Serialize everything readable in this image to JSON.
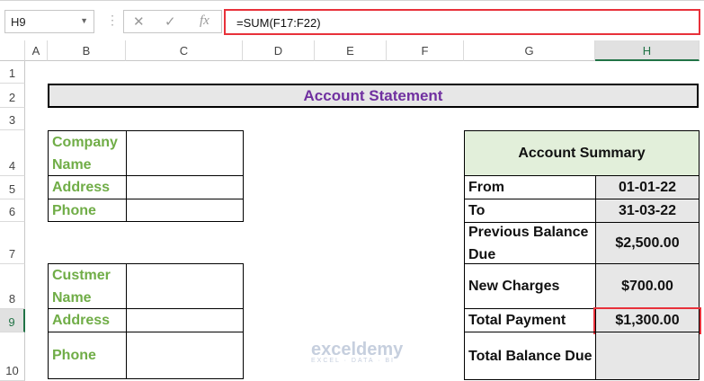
{
  "formula_bar": {
    "name_box": "H9",
    "formula": "=SUM(F17:F22)"
  },
  "columns": [
    "A",
    "B",
    "C",
    "D",
    "E",
    "F",
    "G",
    "H"
  ],
  "rows": [
    "1",
    "2",
    "3",
    "4",
    "5",
    "6",
    "7",
    "8",
    "9",
    "10"
  ],
  "sheet": {
    "title": "Account Statement",
    "company": {
      "name_label": "Company Name",
      "address_label": "Address",
      "phone_label": "Phone"
    },
    "customer": {
      "name_label": "Custmer Name",
      "address_label": "Address",
      "phone_label": "Phone"
    },
    "summary": {
      "header": "Account Summary",
      "items": [
        {
          "label": "From",
          "value": "01-01-22"
        },
        {
          "label": "To",
          "value": "31-03-22"
        },
        {
          "label": "Previous Balance Due",
          "value": "$2,500.00"
        },
        {
          "label": "New Charges",
          "value": "$700.00"
        },
        {
          "label": "Total Payment",
          "value": "$1,300.00"
        },
        {
          "label": "Total Balance Due",
          "value": ""
        }
      ]
    }
  },
  "watermark": {
    "brand": "exceldemy",
    "tagline": "EXCEL · DATA · BI"
  },
  "colors": {
    "label_green": "#70ad47",
    "title_purple": "#7030a0",
    "highlight_red": "#e8313a"
  }
}
